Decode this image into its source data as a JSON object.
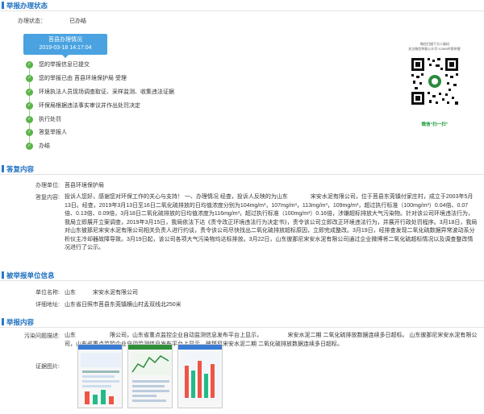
{
  "sections": {
    "status": "举报办理状态",
    "reply": "答复内容",
    "reported": "被举报单位信息",
    "report": "举报内容"
  },
  "status": {
    "label": "办理状态：",
    "value": "已办结",
    "box_title": "莒县办理情况",
    "box_time": "2019-03-18 14:17:04"
  },
  "steps": [
    "您的举报信息已提交",
    "您的举报已由 莒县环境保护局 受理",
    "环境执法人员现场调查取证、采样监测、收集违法证据",
    "环保局根据违法事实审议并作出处罚决定",
    "执行处罚",
    "答复举报人",
    "办结"
  ],
  "qr": {
    "caption1": "微信扫描下方二维码",
    "caption2": "关注微信举报公众号“12369环保举报”",
    "scan_label": "微信“扫一扫”"
  },
  "reply": {
    "unit_label": "办理单位:",
    "unit_value": "莒县环境保护局",
    "content_label": "答复内容:",
    "content_value": "投诉人您好，感谢您对环保工作的关心与支持！ 一、办理情况 经查，投诉人反映的为山东　　　　宋安水泥有限公司，位于莒县东莞镇付家庄村，成立于2003年5月13日。经查，2019年3月13日至16日二氧化硫排放的日均值浓度分别为104mg/m³，107mg/m³，113mg/m³，109mg/m³，超过执行标准（100mg/m³）0.04倍、0.07倍、0.13倍、0.09倍，3月18日二氧化硫排放的日均值浓度为116mg/m³，超过执行标准（100mg/m³）0.16倍，涉嫌超标排放大气污染物。针对该公司环境违法行为，我局立即展开立案调查，2019年3月15日，我局依法下达《责令改正环境违法行为决定书》，责令该公司立即改正环境违法行为，并展开行政处罚程序。3月18日，我局对山东彼那尼宋安水泥有限公司相关负责人进行约谈，责令该公司尽快找出二氧化硫排放超标原因，立即完成整改。3月19日，经排查发现二氧化硫数据异常波动系分析仪主冷却器故障导致。3月19日起，该公司各项大气污染物均达标排放。3月22日，山东彼那尼宋安水泥有限公司通过企业微博将二氧化硫超标情况以及调查整改情况进行了公示。"
  },
  "reported": {
    "name_label": "单位名称:",
    "name_value": "山东　　　宋安水泥有限公司",
    "addr_label": "详细地址:",
    "addr_value": "山东省日照市莒县东莞镇横山村孟双线北250米"
  },
  "report": {
    "desc_label": "污染问题描述:",
    "desc_value": "山东　　　　　　限公司，山东省重点监控企业自动监测信息发布平台上显示，　　　　　宋安水泥二期 二氧化硫排放数据连续多日超标。 山东彼那尼宋安水泥有限公司，山东省重点监控企业自动监测信息发布平台上显示，彼那尼宋安水泥二期 二氧化硫排放数据连续多日超标。",
    "evidence_label": "证据图片:"
  }
}
